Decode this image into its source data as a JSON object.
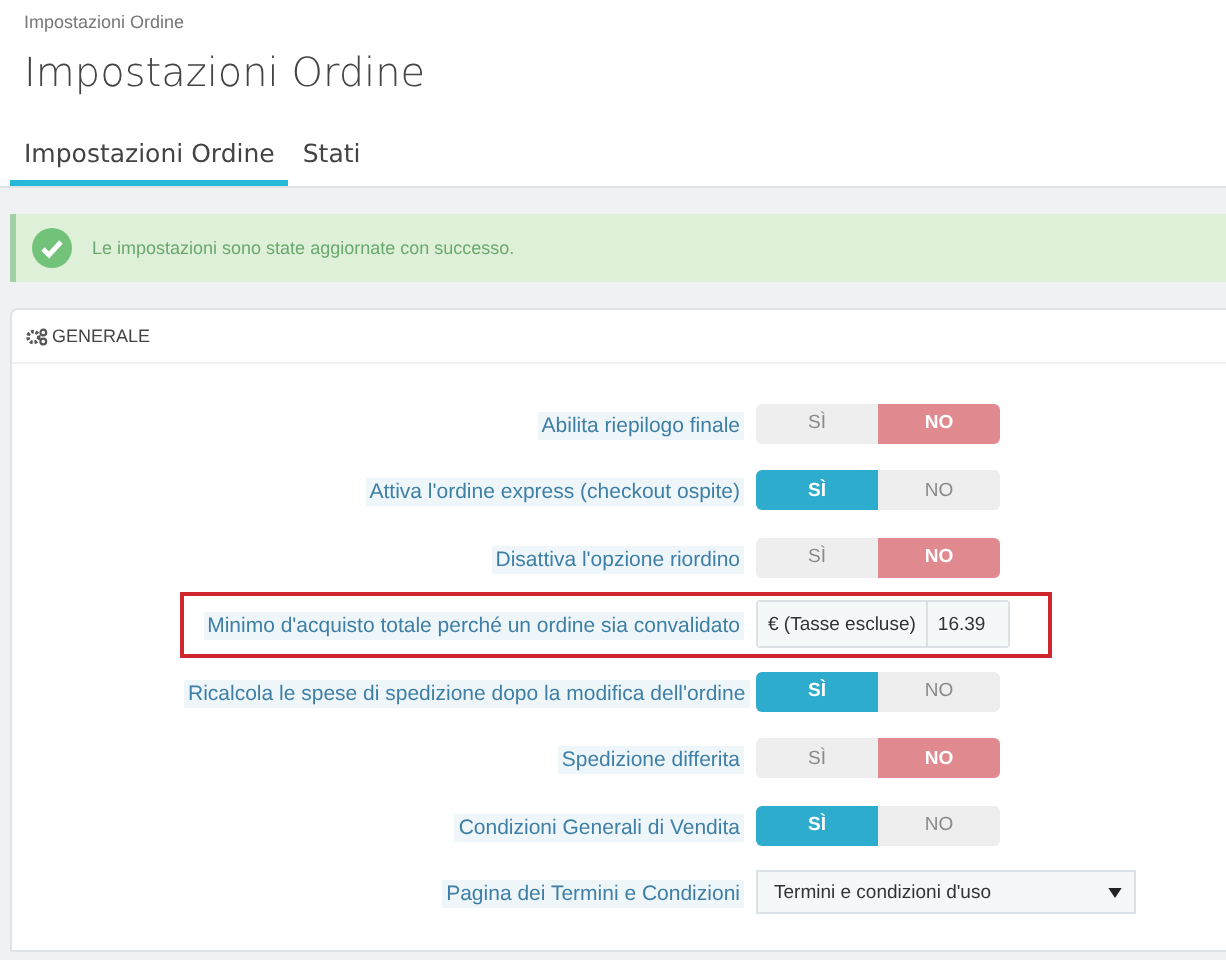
{
  "breadcrumb": "Impostazioni Ordine",
  "title": "Impostazioni Ordine",
  "tabs": [
    {
      "label": "Impostazioni Ordine",
      "selected": true
    },
    {
      "label": "Stati",
      "selected": false
    }
  ],
  "alert": {
    "message": "Le impostazioni sono state aggiornate con successo."
  },
  "panel": {
    "title": "GENERALE",
    "rows": [
      {
        "kind": "toggle",
        "label": "Abilita riepilogo finale",
        "highlighted": false,
        "options": [
          {
            "label": "SÌ",
            "selected": false
          },
          {
            "label": "NO",
            "selected": true
          }
        ]
      },
      {
        "kind": "toggle",
        "label": "Attiva l'ordine express (checkout ospite)",
        "highlighted": false,
        "options": [
          {
            "label": "SÌ",
            "selected": true
          },
          {
            "label": "NO",
            "selected": false
          }
        ]
      },
      {
        "kind": "toggle",
        "label": "Disattiva l'opzione riordino",
        "highlighted": false,
        "options": [
          {
            "label": "SÌ",
            "selected": false
          },
          {
            "label": "NO",
            "selected": true
          }
        ]
      },
      {
        "kind": "input",
        "label": "Minimo d'acquisto totale perché un ordine sia convalidato",
        "highlighted": true,
        "addon": "€ (Tasse escluse)",
        "value": "16.39"
      },
      {
        "kind": "toggle",
        "label": "Ricalcola le spese di spedizione dopo la modifica dell'ordine",
        "highlighted": false,
        "options": [
          {
            "label": "SÌ",
            "selected": true
          },
          {
            "label": "NO",
            "selected": false
          }
        ]
      },
      {
        "kind": "toggle",
        "label": "Spedizione differita",
        "highlighted": false,
        "options": [
          {
            "label": "SÌ",
            "selected": false
          },
          {
            "label": "NO",
            "selected": true
          }
        ]
      },
      {
        "kind": "toggle",
        "label": "Condizioni Generali di Vendita",
        "highlighted": false,
        "options": [
          {
            "label": "SÌ",
            "selected": true
          },
          {
            "label": "NO",
            "selected": false
          }
        ]
      },
      {
        "kind": "select",
        "label": "Pagina dei Termini e Condizioni",
        "highlighted": false,
        "value": "Termini e condizioni d'uso"
      }
    ]
  }
}
